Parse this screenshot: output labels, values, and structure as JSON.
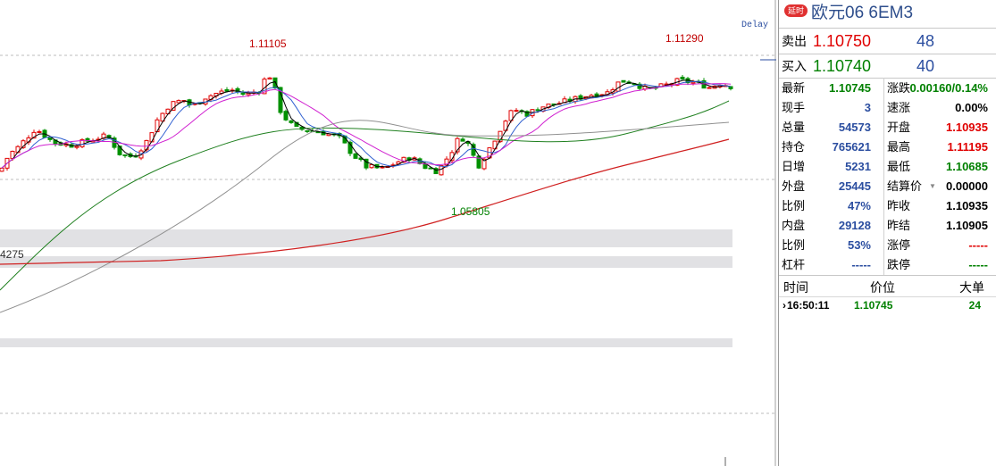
{
  "chart": {
    "delay_label": "Delay",
    "high_label": "1.11105",
    "high2_label": "1.11290",
    "low_label": "1.05805",
    "left_edge_label": "4275",
    "colors": {
      "up": "#e00000",
      "down": "#009000",
      "ma5": "#000000",
      "ma10": "#3060d0",
      "ma20": "#d020d0",
      "ma60": "#208020",
      "ma120": "#909090",
      "ma250": "#d02020"
    }
  },
  "panel": {
    "badge": "延时",
    "symbol": "欧元06  6EM3",
    "sell": {
      "label": "卖出",
      "price": "1.10750",
      "volume": "48"
    },
    "buy": {
      "label": "买入",
      "price": "1.10740",
      "volume": "40"
    },
    "rows": [
      {
        "l1": "最新",
        "v1": "1.10745",
        "c1": "green",
        "l2": "涨跌",
        "v2": "0.00160/0.14%",
        "c2": "green"
      },
      {
        "l1": "现手",
        "v1": "3",
        "c1": "blue",
        "l2": "速涨",
        "v2": "0.00%",
        "c2": "black"
      },
      {
        "l1": "总量",
        "v1": "54573",
        "c1": "blue",
        "l2": "开盘",
        "v2": "1.10935",
        "c2": "red"
      },
      {
        "l1": "持仓",
        "v1": "765621",
        "c1": "blue",
        "l2": "最高",
        "v2": "1.11195",
        "c2": "red"
      },
      {
        "l1": "日增",
        "v1": "5231",
        "c1": "blue",
        "l2": "最低",
        "v2": "1.10685",
        "c2": "green"
      },
      {
        "l1": "外盘",
        "v1": "25445",
        "c1": "blue",
        "l2": "结算价",
        "v2": "0.00000",
        "c2": "black",
        "dropdown": true
      },
      {
        "l1": "比例",
        "v1": "47%",
        "c1": "blue",
        "l2": "昨收",
        "v2": "1.10935",
        "c2": "black"
      },
      {
        "l1": "内盘",
        "v1": "29128",
        "c1": "blue",
        "l2": "昨结",
        "v2": "1.10905",
        "c2": "black"
      },
      {
        "l1": "比例",
        "v1": "53%",
        "c1": "blue",
        "l2": "涨停",
        "v2": "-----",
        "c2": "red"
      },
      {
        "l1": "杠杆",
        "v1": "-----",
        "c1": "blue",
        "l2": "跌停",
        "v2": "-----",
        "c2": "green"
      }
    ],
    "ticks_header": {
      "time": "时间",
      "price": "价位",
      "size": "大单"
    },
    "tick": {
      "time": "16:50:11",
      "price": "1.10745",
      "size": "24"
    }
  }
}
